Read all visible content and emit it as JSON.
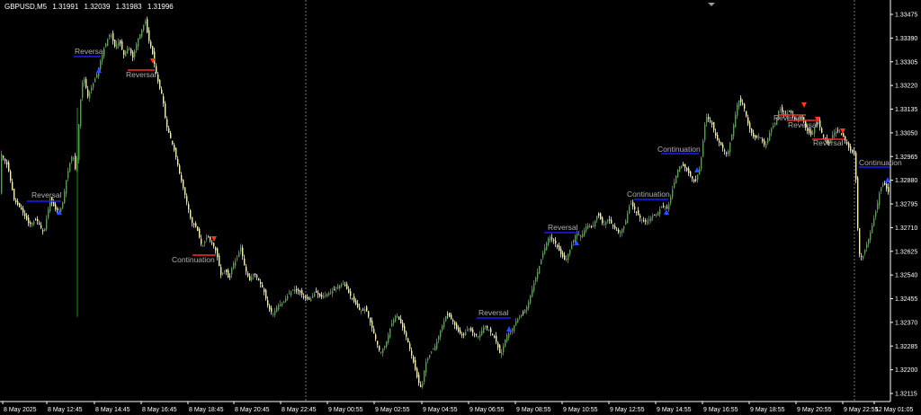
{
  "header": {
    "symbol": "GBPUSD,M5",
    "quote": [
      "1.31991",
      "1.32039",
      "1.31983",
      "1.31996"
    ]
  },
  "colors": {
    "background": "#000000",
    "axis": "#ffffff",
    "up": "#2fbf1f",
    "down": "#ffff66",
    "signal_buy_line": "#1a1aff",
    "signal_sell_line": "#ff2a2a",
    "label": "#b0b0b0"
  },
  "chart_data": {
    "type": "candlestick",
    "yticks": [
      "1.33475",
      "1.33390",
      "1.33305",
      "1.33220",
      "1.33135",
      "1.33050",
      "1.32965",
      "1.32880",
      "1.32795",
      "1.32710",
      "1.32625",
      "1.32540",
      "1.32455",
      "1.32370",
      "1.32285",
      "1.32200",
      "1.32115"
    ],
    "xticks": [
      "8 May 2025",
      "8 May 12:45",
      "8 May 14:45",
      "8 May 16:45",
      "8 May 18:45",
      "8 May 20:45",
      "8 May 22:45",
      "9 May 00:55",
      "9 May 02:55",
      "9 May 04:55",
      "9 May 06:55",
      "9 May 08:55",
      "9 May 10:55",
      "9 May 12:55",
      "9 May 14:55",
      "9 May 16:55",
      "9 May 18:55",
      "9 May 20:55",
      "9 May 22:55",
      "12 May 01:05"
    ],
    "session_breaks": [
      "8 May 22:45",
      "9 May 22:55"
    ],
    "price_path": [
      [
        0,
        1.3298
      ],
      [
        8,
        1.3293
      ],
      [
        15,
        1.3281
      ],
      [
        24,
        1.3277
      ],
      [
        32,
        1.3272
      ],
      [
        40,
        1.3274
      ],
      [
        48,
        1.3269
      ],
      [
        55,
        1.3281
      ],
      [
        62,
        1.3277
      ],
      [
        68,
        1.3278
      ],
      [
        74,
        1.329
      ],
      [
        80,
        1.3298
      ],
      [
        84,
        1.329
      ],
      [
        88,
        1.3314
      ],
      [
        92,
        1.3326
      ],
      [
        97,
        1.3318
      ],
      [
        102,
        1.3322
      ],
      [
        107,
        1.3326
      ],
      [
        112,
        1.3332
      ],
      [
        117,
        1.3337
      ],
      [
        122,
        1.3341
      ],
      [
        127,
        1.3336
      ],
      [
        132,
        1.3338
      ],
      [
        137,
        1.3333
      ],
      [
        142,
        1.3336
      ],
      [
        147,
        1.3332
      ],
      [
        152,
        1.3338
      ],
      [
        157,
        1.3342
      ],
      [
        161,
        1.3345
      ],
      [
        164,
        1.3339
      ],
      [
        168,
        1.3335
      ],
      [
        172,
        1.3328
      ],
      [
        176,
        1.3322
      ],
      [
        180,
        1.3318
      ],
      [
        184,
        1.3308
      ],
      [
        188,
        1.3304
      ],
      [
        192,
        1.33
      ],
      [
        196,
        1.3295
      ],
      [
        200,
        1.3289
      ],
      [
        204,
        1.3284
      ],
      [
        208,
        1.3279
      ],
      [
        212,
        1.3273
      ],
      [
        218,
        1.3271
      ],
      [
        224,
        1.3264
      ],
      [
        230,
        1.3268
      ],
      [
        236,
        1.3265
      ],
      [
        240,
        1.3262
      ],
      [
        245,
        1.3254
      ],
      [
        250,
        1.3256
      ],
      [
        254,
        1.3252
      ],
      [
        258,
        1.3258
      ],
      [
        262,
        1.3259
      ],
      [
        267,
        1.3264
      ],
      [
        272,
        1.3256
      ],
      [
        277,
        1.3252
      ],
      [
        282,
        1.3255
      ],
      [
        287,
        1.3252
      ],
      [
        292,
        1.3249
      ],
      [
        298,
        1.3242
      ],
      [
        303,
        1.324
      ],
      [
        308,
        1.3243
      ],
      [
        314,
        1.3244
      ],
      [
        320,
        1.3247
      ],
      [
        326,
        1.3249
      ],
      [
        332,
        1.3248
      ],
      [
        338,
        1.3246
      ],
      [
        344,
        1.3245
      ],
      [
        350,
        1.3248
      ],
      [
        356,
        1.3246
      ],
      [
        362,
        1.3247
      ],
      [
        368,
        1.3248
      ],
      [
        375,
        1.325
      ],
      [
        382,
        1.3251
      ],
      [
        388,
        1.3247
      ],
      [
        394,
        1.3244
      ],
      [
        400,
        1.3241
      ],
      [
        406,
        1.3242
      ],
      [
        410,
        1.3238
      ],
      [
        416,
        1.3232
      ],
      [
        422,
        1.3226
      ],
      [
        428,
        1.3229
      ],
      [
        434,
        1.3236
      ],
      [
        440,
        1.324
      ],
      [
        446,
        1.3236
      ],
      [
        452,
        1.3231
      ],
      [
        458,
        1.3224
      ],
      [
        464,
        1.3216
      ],
      [
        468,
        1.3213
      ],
      [
        472,
        1.3222
      ],
      [
        478,
        1.3226
      ],
      [
        484,
        1.3229
      ],
      [
        490,
        1.3235
      ],
      [
        496,
        1.324
      ],
      [
        502,
        1.3238
      ],
      [
        508,
        1.3234
      ],
      [
        514,
        1.3232
      ],
      [
        520,
        1.3235
      ],
      [
        526,
        1.3233
      ],
      [
        532,
        1.3232
      ],
      [
        538,
        1.3236
      ],
      [
        544,
        1.3234
      ],
      [
        550,
        1.3231
      ],
      [
        556,
        1.3225
      ],
      [
        562,
        1.3232
      ],
      [
        568,
        1.3234
      ],
      [
        574,
        1.3238
      ],
      [
        580,
        1.324
      ],
      [
        586,
        1.3243
      ],
      [
        592,
        1.325
      ],
      [
        598,
        1.3256
      ],
      [
        604,
        1.3263
      ],
      [
        610,
        1.3268
      ],
      [
        616,
        1.3266
      ],
      [
        622,
        1.3262
      ],
      [
        628,
        1.3259
      ],
      [
        634,
        1.3264
      ],
      [
        640,
        1.3269
      ],
      [
        646,
        1.3268
      ],
      [
        652,
        1.3272
      ],
      [
        658,
        1.3271
      ],
      [
        664,
        1.3276
      ],
      [
        670,
        1.3272
      ],
      [
        676,
        1.3274
      ],
      [
        682,
        1.3271
      ],
      [
        688,
        1.3269
      ],
      [
        694,
        1.3272
      ],
      [
        700,
        1.328
      ],
      [
        706,
        1.3277
      ],
      [
        712,
        1.3274
      ],
      [
        718,
        1.3273
      ],
      [
        724,
        1.3275
      ],
      [
        730,
        1.3276
      ],
      [
        736,
        1.3279
      ],
      [
        742,
        1.3278
      ],
      [
        748,
        1.3286
      ],
      [
        754,
        1.3293
      ],
      [
        760,
        1.3293
      ],
      [
        766,
        1.329
      ],
      [
        772,
        1.3287
      ],
      [
        778,
        1.3293
      ],
      [
        784,
        1.3311
      ],
      [
        790,
        1.3309
      ],
      [
        796,
        1.3303
      ],
      [
        802,
        1.33
      ],
      [
        808,
        1.3297
      ],
      [
        814,
        1.3306
      ],
      [
        820,
        1.3317
      ],
      [
        826,
        1.3315
      ],
      [
        832,
        1.3307
      ],
      [
        838,
        1.3303
      ],
      [
        844,
        1.3304
      ],
      [
        850,
        1.33
      ],
      [
        856,
        1.3306
      ],
      [
        862,
        1.3309
      ],
      [
        866,
        1.3314
      ],
      [
        872,
        1.3311
      ],
      [
        878,
        1.3313
      ],
      [
        884,
        1.3309
      ],
      [
        890,
        1.3312
      ],
      [
        896,
        1.3306
      ],
      [
        902,
        1.3304
      ],
      [
        908,
        1.331
      ],
      [
        914,
        1.3304
      ],
      [
        920,
        1.3301
      ],
      [
        926,
        1.3305
      ],
      [
        932,
        1.3306
      ],
      [
        938,
        1.3303
      ],
      [
        944,
        1.3299
      ],
      [
        950,
        1.3297
      ],
      [
        954,
        1.3262
      ],
      [
        958,
        1.326
      ],
      [
        962,
        1.3264
      ],
      [
        966,
        1.3268
      ],
      [
        970,
        1.3273
      ],
      [
        974,
        1.3278
      ],
      [
        978,
        1.3285
      ],
      [
        982,
        1.3287
      ],
      [
        988,
        1.3283
      ]
    ],
    "annotations": [
      {
        "text": "Reversal",
        "direction": "buy"
      },
      {
        "text": "Reversal",
        "direction": "buy"
      },
      {
        "text": "Reversal",
        "direction": "sell"
      },
      {
        "text": "Continuation",
        "direction": "sell"
      },
      {
        "text": "Reversal",
        "direction": "buy"
      },
      {
        "text": "Reversal",
        "direction": "buy"
      },
      {
        "text": "Continuation",
        "direction": "buy"
      },
      {
        "text": "Continuation",
        "direction": "buy"
      },
      {
        "text": "Reversal",
        "direction": "sell"
      },
      {
        "text": "Reversal",
        "direction": "sell"
      },
      {
        "text": "Reversal",
        "direction": "sell"
      },
      {
        "text": "Continuation",
        "direction": "buy"
      }
    ]
  }
}
